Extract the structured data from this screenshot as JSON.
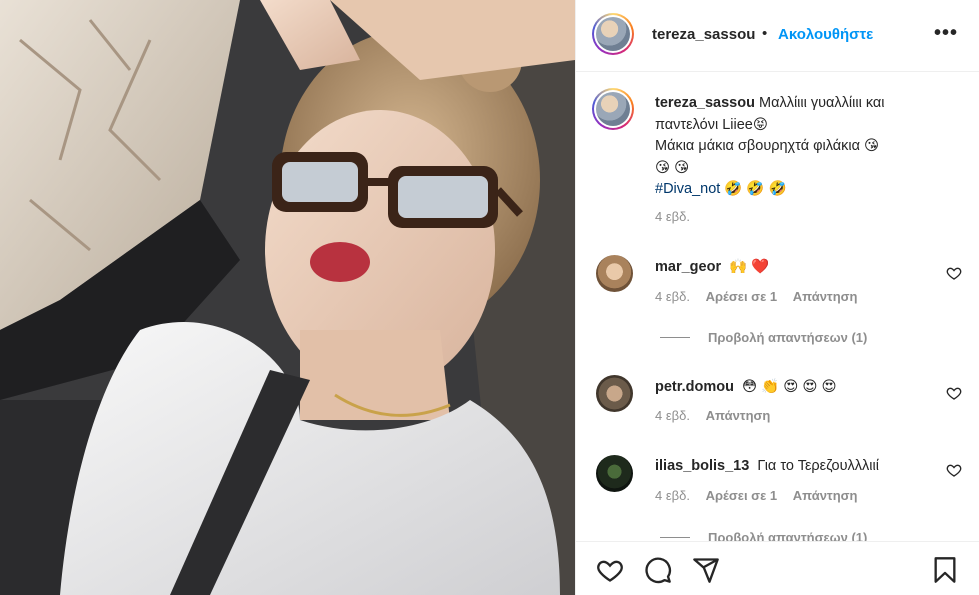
{
  "post": {
    "username": "tereza_sassou",
    "dot": "•",
    "follow_label": "Ακολουθήστε",
    "more_label": "•••"
  },
  "caption": {
    "username": "tereza_sassou",
    "line1": "Μαλλίιιι γυαλλίιιι και",
    "line2": "παντελόνι Liiee😝",
    "line3": "Μάκια μάκια σβουρηχτά φιλάκια 😘",
    "line4": "😘 😘",
    "hashtag": "#Diva_not",
    "emojis": "🤣 🤣 🤣",
    "time": "4 εβδ."
  },
  "comments": [
    {
      "username": "mar_geor",
      "text": "🙌 ❤️",
      "time": "4 εβδ.",
      "likes": "Αρέσει σε 1",
      "reply": "Απάντηση",
      "view_replies": "Προβολή απαντήσεων (1)"
    },
    {
      "username": "petr.domou",
      "text": "😳 👏 😍 😍 😍",
      "time": "4 εβδ.",
      "reply": "Απάντηση"
    },
    {
      "username": "ilias_bolis_13",
      "text": "Για το Τερεζουλλλιιί",
      "time": "4 εβδ.",
      "likes": "Αρέσει σε 1",
      "reply": "Απάντηση",
      "view_replies": "Προβολή απαντήσεων (1)"
    }
  ],
  "icons": {
    "like": "heart-icon",
    "comment": "comment-icon",
    "share": "share-icon",
    "save": "bookmark-icon"
  }
}
